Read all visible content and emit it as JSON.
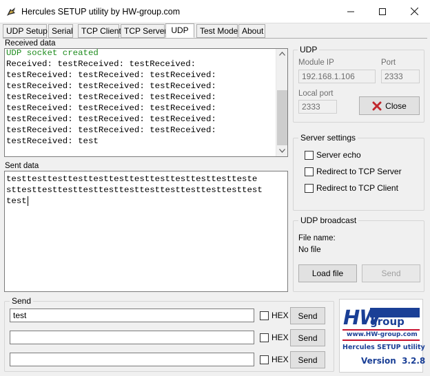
{
  "window": {
    "title": "Hercules SETUP utility by HW-group.com",
    "minimize_icon": "minimize-icon",
    "maximize_icon": "maximize-icon",
    "close_icon": "close-icon"
  },
  "tabs": [
    {
      "label": "UDP Setup"
    },
    {
      "label": "Serial"
    },
    {
      "label": "TCP Client"
    },
    {
      "label": "TCP Server"
    },
    {
      "label": "UDP",
      "active": true
    },
    {
      "label": "Test Mode"
    },
    {
      "label": "About"
    }
  ],
  "received": {
    "label": "Received data",
    "lines": [
      "UDP socket created",
      "Received: testReceived: testReceived:",
      "testReceived: testReceived: testReceived:",
      "testReceived: testReceived: testReceived:",
      "testReceived: testReceived: testReceived:",
      "testReceived: testReceived: testReceived:",
      "testReceived: testReceived: testReceived:",
      "testReceived: testReceived: testReceived:",
      "testReceived: test"
    ]
  },
  "sent": {
    "label": "Sent data",
    "lines": [
      "testtesttesttesttesttesttesttesttesttesttestteste",
      "sttesttesttesttesttesttesttesttesttesttesttesttest",
      "test"
    ]
  },
  "udp": {
    "title": "UDP",
    "module_ip_label": "Module IP",
    "module_ip": "192.168.1.106",
    "port_label": "Port",
    "port": "2333",
    "local_port_label": "Local port",
    "local_port": "2333",
    "close_label": "Close"
  },
  "server_settings": {
    "title": "Server settings",
    "options": [
      "Server echo",
      "Redirect to TCP Server",
      "Redirect to TCP Client"
    ]
  },
  "broadcast": {
    "title": "UDP broadcast",
    "file_name_label": "File name:",
    "file_value": "No file",
    "load_label": "Load file",
    "send_label": "Send"
  },
  "send": {
    "title": "Send",
    "rows": [
      {
        "value": "test",
        "hex_label": "HEX",
        "send_label": "Send"
      },
      {
        "value": "",
        "hex_label": "HEX",
        "send_label": "Send"
      },
      {
        "value": "",
        "hex_label": "HEX",
        "send_label": "Send"
      }
    ]
  },
  "logo": {
    "brand_hw": "HW",
    "brand_group": "group",
    "url": "www.HW-group.com",
    "product": "Hercules SETUP utility",
    "version": "Version  3.2.8"
  },
  "colors": {
    "logo_blue": "#1a3f96",
    "logo_red": "#c8102e",
    "received_status_green": "#1e8c1e"
  }
}
